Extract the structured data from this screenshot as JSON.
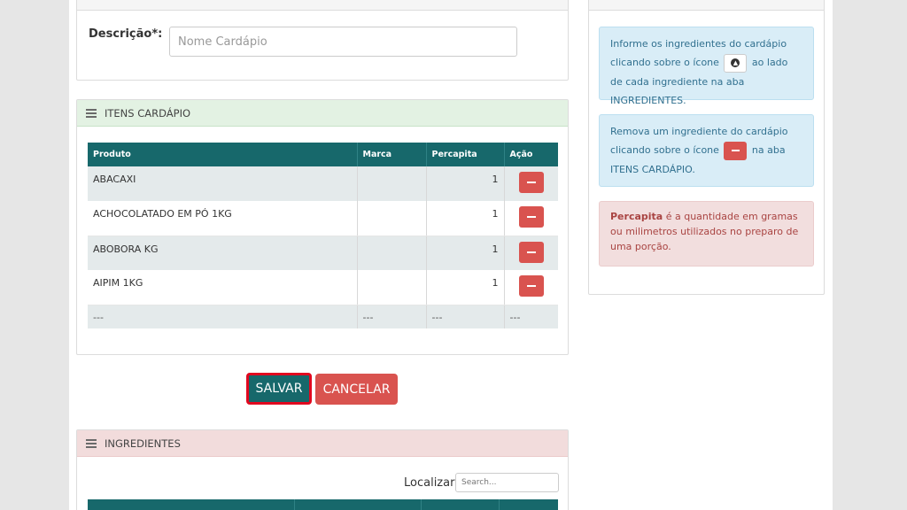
{
  "descricao": {
    "label": "Descrição*:",
    "placeholder": "Nome Cardápio",
    "value": ""
  },
  "itens": {
    "title": "ITENS CARDÁPIO",
    "columns": [
      "Produto",
      "Marca",
      "Percapita",
      "Ação"
    ],
    "rows": [
      {
        "produto": "ABACAXI",
        "marca": "",
        "percapita": "1"
      },
      {
        "produto": "ACHOCOLATADO EM PÓ 1KG",
        "marca": "",
        "percapita": "1"
      },
      {
        "produto": "ABOBORA KG",
        "marca": "",
        "percapita": "1"
      },
      {
        "produto": "AIPIM 1KG",
        "marca": "",
        "percapita": "1"
      }
    ],
    "empty_row": [
      "---",
      "---",
      "---",
      "---"
    ]
  },
  "actions": {
    "save_label": "SALVAR",
    "cancel_label": "CANCELAR"
  },
  "ingredientes": {
    "title": "INGREDIENTES",
    "search_label": "Localizar:",
    "search_placeholder": "Search..."
  },
  "sidebar": {
    "alert_add": {
      "part1": "Informe os ingredientes do cardápio clicando sobre o ícone",
      "part2": "ao lado de cada ingrediente na aba INGREDIENTES."
    },
    "alert_remove": {
      "part1": "Remova um ingrediente do cardápio clicando sobre o ícone",
      "part2": "na aba ITENS CARDÁPIO."
    },
    "alert_percapita": {
      "term": "Percapita",
      "text": " é a quantidade em gramas ou milimetros utilizados no preparo de uma porção."
    }
  },
  "icons": {
    "panel_header": "list-icon",
    "add": "arrow-circle-up-icon",
    "remove": "minus-icon"
  },
  "colors": {
    "primary": "#17686b",
    "danger": "#d9534f",
    "focus_outline": "#e1081f",
    "info_bg": "#d9edf7",
    "danger_bg": "#f2dede"
  }
}
